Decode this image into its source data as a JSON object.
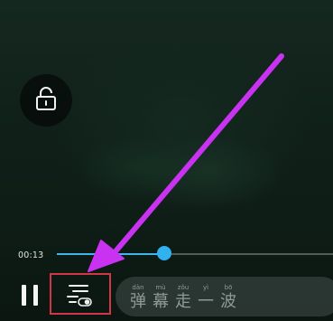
{
  "player": {
    "current_time": "00:13",
    "progress": 0.39,
    "danmaku_placeholder": [
      {
        "pinyin": "dàn",
        "hanzi": "弹"
      },
      {
        "pinyin": "mù",
        "hanzi": "幕"
      },
      {
        "pinyin": "zǒu",
        "hanzi": "走"
      },
      {
        "pinyin": "yì",
        "hanzi": "一"
      },
      {
        "pinyin": "bō",
        "hanzi": "波"
      }
    ]
  },
  "colors": {
    "accent": "#31b2ee",
    "highlight_box": "#d43646",
    "annotation_arrow": "#c832f0"
  },
  "icons": {
    "lock": "unlock-icon",
    "pause": "pause-icon",
    "danmaku": "danmaku-settings-icon"
  }
}
